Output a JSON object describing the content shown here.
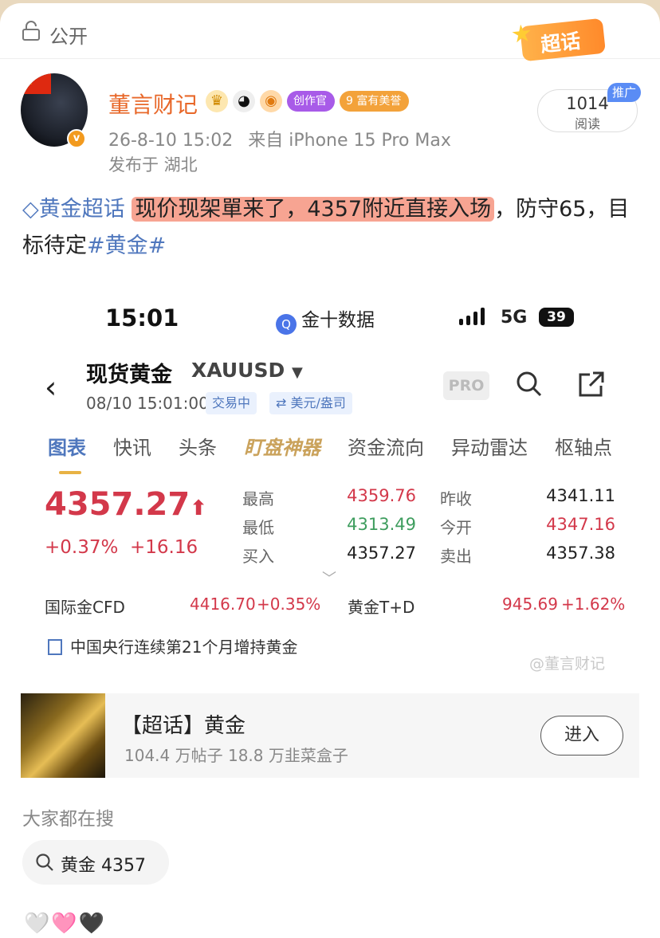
{
  "header": {
    "visibility_label": "公开",
    "super_topic_badge": "超话"
  },
  "author": {
    "name": "董言财记",
    "tags": [
      "创作官",
      "富有美誉"
    ],
    "tag_level": "9",
    "post_time": "26-8-10 15:02",
    "source": "来自 iPhone 15 Pro Max",
    "location": "发布于 湖北",
    "verified_mark": "v"
  },
  "reads": {
    "count": "1014",
    "label": "阅读",
    "promo": "推广"
  },
  "post": {
    "topic": "黄金超话",
    "highlight": "现价现架單来了，4357附近直接入场",
    "rest": "，防守65，目标待定",
    "hashtag": "#黄金#"
  },
  "screenshot": {
    "status": {
      "time": "15:01",
      "app": "金十数据",
      "app_icon": "Q",
      "network": "5G",
      "battery": "39"
    },
    "instrument": {
      "name": "现货黄金",
      "symbol": "XAUUSD",
      "quote_time": "08/10 15:01:00",
      "trade_status": "交易中",
      "unit": "⇄ 美元/盎司",
      "pro_label": "PRO"
    },
    "tabs": [
      "图表",
      "快讯",
      "头条",
      "盯盘神器",
      "资金流向",
      "异动雷达",
      "枢轴点"
    ],
    "quote": {
      "price": "4357.27",
      "change_pct": "+0.37%",
      "change_abs": "+16.16",
      "high_label": "最高",
      "high": "4359.76",
      "low_label": "最低",
      "low": "4313.49",
      "bid_label": "买入",
      "bid": "4357.27",
      "prev_close_label": "昨收",
      "prev_close": "4341.11",
      "open_label": "今开",
      "open": "4347.16",
      "ask_label": "卖出",
      "ask": "4357.38"
    },
    "related": {
      "cfd_label": "国际金CFD",
      "cfd_value": "4416.70",
      "cfd_change": "+0.35%",
      "td_label": "黄金T+D",
      "td_value": "945.69",
      "td_change": "+1.62%"
    },
    "news": "中国央行连续第21个月增持黄金",
    "watermark": "@董言财记"
  },
  "topic_card": {
    "title": "【超话】黄金",
    "stats": "104.4 万帖子 18.8 万韭菜盒子",
    "enter_label": "进入"
  },
  "search": {
    "heading": "大家都在搜",
    "chip": "黄金 4357"
  },
  "reactions": "🤍🩷🖤",
  "colors": {
    "up": "#d3384a",
    "down": "#3e9d5e",
    "accent": "#4f77bd",
    "author": "#e8682a"
  }
}
